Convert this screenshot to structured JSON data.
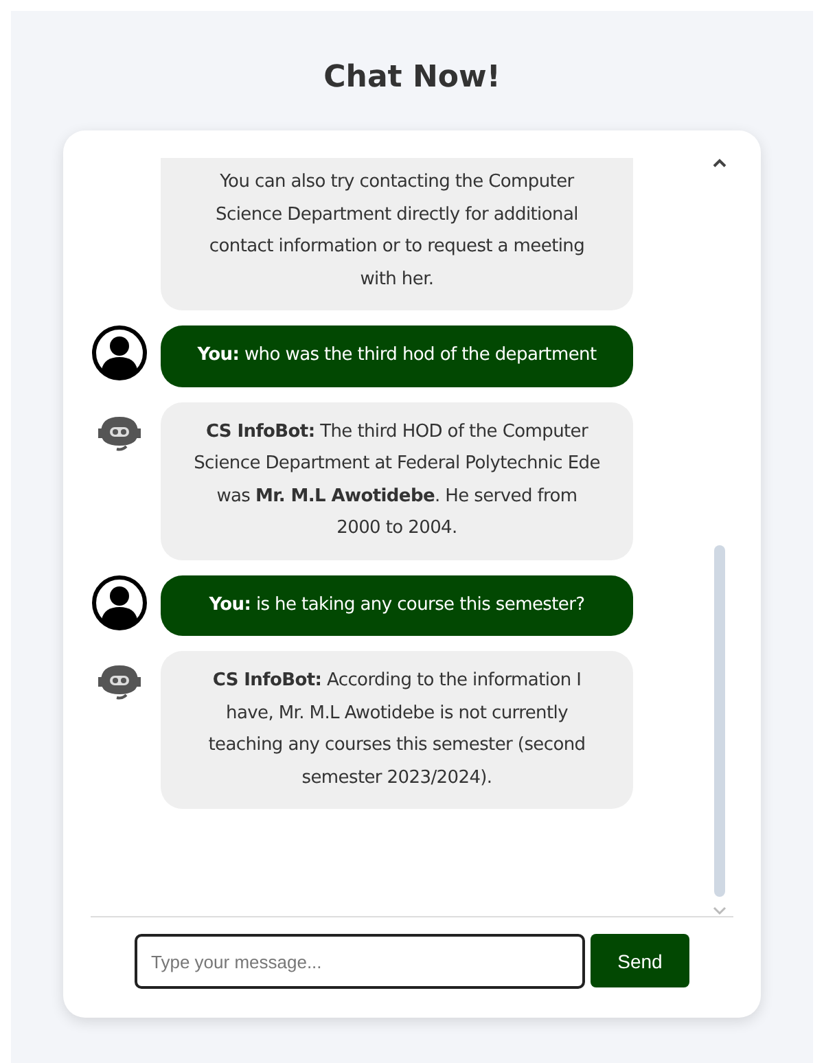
{
  "title": "Chat Now!",
  "messages": [
    {
      "kind": "bot",
      "avatar": false,
      "top_cut": true,
      "text": "You can also try contacting the Computer Science Department directly for additional contact information or to request a meeting with her."
    },
    {
      "kind": "user",
      "avatar": true,
      "text": "**You:** who was the third hod of the department"
    },
    {
      "kind": "bot",
      "avatar": true,
      "text": "**CS InfoBot:** The third HOD of the Computer Science Department at Federal Polytechnic Ede was **Mr. M.L Awotidebe**. He served from 2000 to 2004."
    },
    {
      "kind": "user",
      "avatar": true,
      "text": "**You:** is he taking any course this semester?"
    },
    {
      "kind": "bot",
      "avatar": true,
      "text": "**CS InfoBot:** According to the information I have, Mr. M.L Awotidebe is not currently teaching any courses this semester (second semester 2023/2024)."
    }
  ],
  "input": {
    "placeholder": "Type your message..."
  },
  "send_button": "Send"
}
